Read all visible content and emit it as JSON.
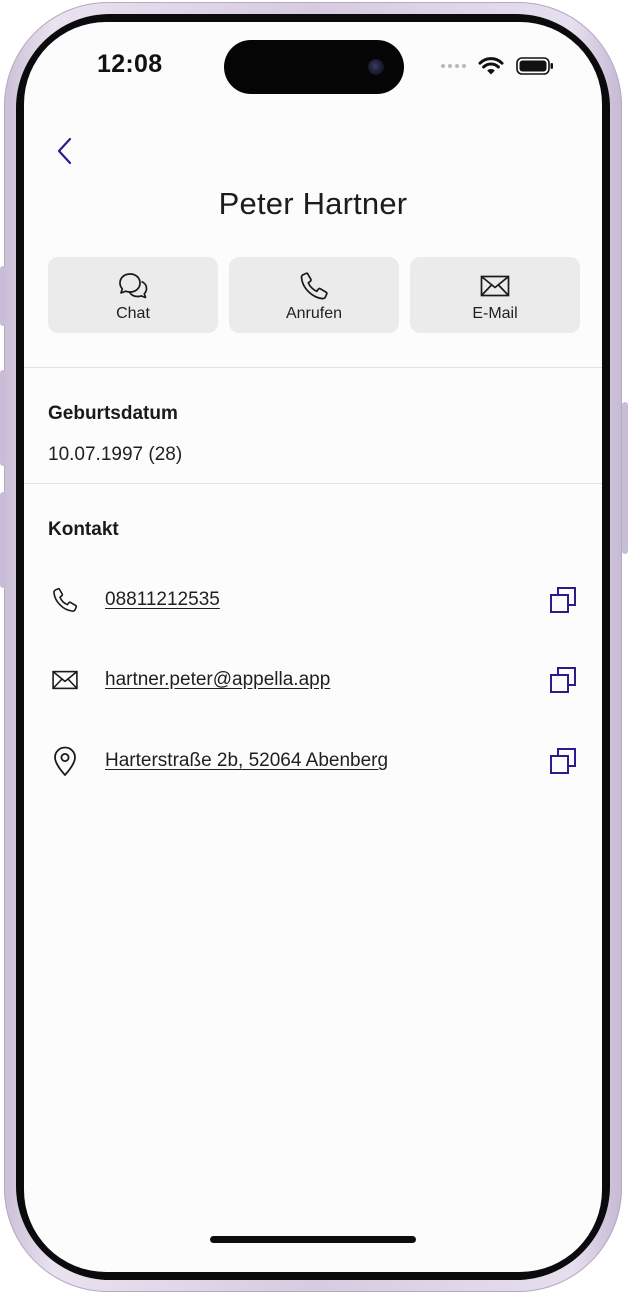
{
  "status_bar": {
    "time": "12:08"
  },
  "header": {
    "title": "Peter Hartner",
    "back_icon": "chevron-left-icon"
  },
  "actions": [
    {
      "label": "Chat",
      "icon": "chat-bubbles-icon"
    },
    {
      "label": "Anrufen",
      "icon": "phone-icon"
    },
    {
      "label": "E-Mail",
      "icon": "envelope-icon"
    }
  ],
  "birthday": {
    "title": "Geburtsdatum",
    "value": "10.07.1997 (28)"
  },
  "contact": {
    "title": "Kontakt",
    "rows": [
      {
        "value": "08811212535",
        "icon": "phone-icon",
        "action_icon": "copy-icon"
      },
      {
        "value": "hartner.peter@appella.app",
        "icon": "envelope-icon",
        "action_icon": "copy-icon"
      },
      {
        "value": "Harterstraße 2b, 52064 Abenberg",
        "icon": "location-pin-icon",
        "action_icon": "copy-icon"
      }
    ]
  },
  "colors": {
    "accent": "#2a1b8f",
    "button_bg": "#ebebeb",
    "screen_bg": "#fcfcfc",
    "frame": "#d6cbe0"
  }
}
